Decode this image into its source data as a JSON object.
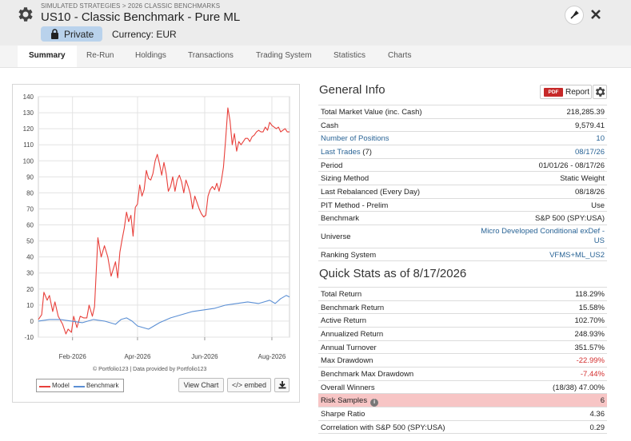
{
  "header": {
    "breadcrumb": "SIMULATED STRATEGIES > 2026 CLASSIC BENCHMARKS",
    "title": "US10 - Classic Benchmark - Pure ML",
    "private_label": "Private",
    "currency_label": "Currency: EUR",
    "icons": [
      "gear-icon",
      "lock-icon",
      "pin-icon",
      "close-icon"
    ]
  },
  "tabs": [
    {
      "label": "Summary",
      "active": true
    },
    {
      "label": "Re-Run"
    },
    {
      "label": "Holdings"
    },
    {
      "label": "Transactions"
    },
    {
      "label": "Trading System"
    },
    {
      "label": "Statistics"
    },
    {
      "label": "Charts"
    }
  ],
  "chart_panel": {
    "credit": "© Portfolio123 | Data provided by Portfolio123",
    "view_chart_label": "View Chart",
    "embed_label": "</> embed",
    "download_icon": "download-icon"
  },
  "chart_data": {
    "type": "line",
    "xlabel": "",
    "ylabel": "",
    "ylim": [
      -10,
      140
    ],
    "yticks": [
      -10,
      0,
      10,
      20,
      30,
      40,
      50,
      60,
      70,
      80,
      90,
      100,
      110,
      120,
      130,
      140
    ],
    "x_tick_labels": [
      "Feb-2026",
      "Apr-2026",
      "Jun-2026",
      "Aug-2026"
    ],
    "x_tick_days": [
      31,
      90,
      151,
      212
    ],
    "x_range_days": [
      0,
      228
    ],
    "grid": true,
    "legend_position": "bottom-left",
    "series": [
      {
        "name": "Model",
        "color": "#e8403b",
        "x": [
          0,
          3,
          5,
          8,
          10,
          13,
          15,
          18,
          22,
          25,
          27,
          30,
          32,
          35,
          38,
          41,
          44,
          46,
          49,
          51,
          54,
          57,
          60,
          63,
          66,
          70,
          72,
          74,
          76,
          78,
          80,
          82,
          84,
          86,
          88,
          90,
          92,
          94,
          96,
          98,
          100,
          102,
          104,
          106,
          108,
          110,
          112,
          114,
          116,
          118,
          120,
          122,
          124,
          126,
          128,
          130,
          132,
          134,
          136,
          138,
          140,
          142,
          144,
          146,
          148,
          150,
          152,
          154,
          156,
          158,
          160,
          162,
          164,
          166,
          168,
          170,
          172,
          174,
          176,
          178,
          180,
          182,
          184,
          186,
          188,
          190,
          192,
          194,
          196,
          198,
          200,
          202,
          204,
          206,
          208,
          210,
          212,
          214,
          216,
          218,
          220,
          222,
          224,
          226,
          228
        ],
        "y": [
          1,
          4,
          18,
          13,
          16,
          6,
          12,
          3,
          -2,
          -8,
          -5,
          -7,
          3,
          -4,
          3,
          2,
          2,
          10,
          3,
          9,
          52,
          40,
          47,
          40,
          28,
          37,
          27,
          43,
          51,
          58,
          68,
          62,
          66,
          53,
          71,
          73,
          85,
          78,
          82,
          94,
          89,
          88,
          92,
          100,
          104,
          98,
          91,
          99,
          92,
          81,
          84,
          90,
          81,
          88,
          91,
          87,
          80,
          88,
          84,
          79,
          70,
          78,
          74,
          70,
          67,
          65,
          66,
          78,
          82,
          84,
          82,
          86,
          81,
          87,
          96,
          113,
          133,
          125,
          110,
          117,
          106,
          112,
          110,
          112,
          114,
          114,
          112,
          115,
          116,
          118,
          119,
          118,
          118,
          121,
          119,
          124,
          122,
          121,
          120,
          121,
          118,
          119,
          120,
          118,
          118
        ],
        "note": "approximate shape read from chart"
      },
      {
        "name": "Benchmark",
        "color": "#5b8fd4",
        "x": [
          0,
          10,
          20,
          30,
          40,
          50,
          60,
          70,
          75,
          80,
          85,
          90,
          95,
          100,
          110,
          120,
          130,
          140,
          150,
          160,
          170,
          180,
          190,
          200,
          205,
          210,
          215,
          220,
          225,
          228
        ],
        "y": [
          0,
          1,
          1,
          0,
          -1,
          1,
          0,
          -2,
          1,
          2,
          0,
          -3,
          -4,
          -5,
          -1,
          2,
          4,
          6,
          7,
          8,
          10,
          11,
          12,
          11,
          12,
          13,
          11,
          14,
          16,
          15
        ]
      }
    ]
  },
  "general_info": {
    "title": "General Info",
    "report_label": "Report",
    "pdf_badge": "PDF",
    "rows": [
      {
        "label": "Total Market Value (inc. Cash)",
        "value": "218,285.39"
      },
      {
        "label": "Cash",
        "value": "9,579.41"
      },
      {
        "label": "Number of Positions",
        "value": "10",
        "link": true
      },
      {
        "label": "Last Trades (7)",
        "value": "08/17/26",
        "link_label": "Last Trades",
        "suffix": " (7)",
        "link_value": true
      },
      {
        "label": "Period",
        "value": "01/01/26 - 08/17/26"
      },
      {
        "label": "Sizing Method",
        "value": "Static Weight"
      },
      {
        "label": "Last Rebalanced (Every Day)",
        "value": "08/18/26"
      },
      {
        "label": "PIT Method - Prelim",
        "value": "Use"
      },
      {
        "label": "Benchmark",
        "value": "S&P 500 (SPY:USA)"
      },
      {
        "label": "Universe",
        "value": "Micro Developed Conditional exDef -",
        "value2": "US",
        "link_value": true,
        "tall": true
      },
      {
        "label": "Ranking System",
        "value": "VFMS+ML_US2",
        "link_value": true
      }
    ]
  },
  "quick_stats": {
    "title": "Quick Stats as of 8/17/2026",
    "rows": [
      {
        "label": "Total Return",
        "value": "118.29%"
      },
      {
        "label": "Benchmark Return",
        "value": "15.58%"
      },
      {
        "label": "Active Return",
        "value": "102.70%"
      },
      {
        "label": "Annualized Return",
        "value": "248.93%"
      },
      {
        "label": "Annual Turnover",
        "value": "351.57%"
      },
      {
        "label": "Max Drawdown",
        "value": "-22.99%",
        "negative": true
      },
      {
        "label": "Benchmark Max Drawdown",
        "value": "-7.44%",
        "negative": true
      },
      {
        "label": "Overall Winners",
        "value": "(18/38) 47.00%"
      },
      {
        "label": "Risk Samples",
        "value": "6",
        "highlight": true,
        "info": true
      },
      {
        "label": "Sharpe Ratio",
        "value": "4.36"
      },
      {
        "label": "Correlation with S&P 500 (SPY:USA)",
        "value": "0.29"
      }
    ]
  }
}
